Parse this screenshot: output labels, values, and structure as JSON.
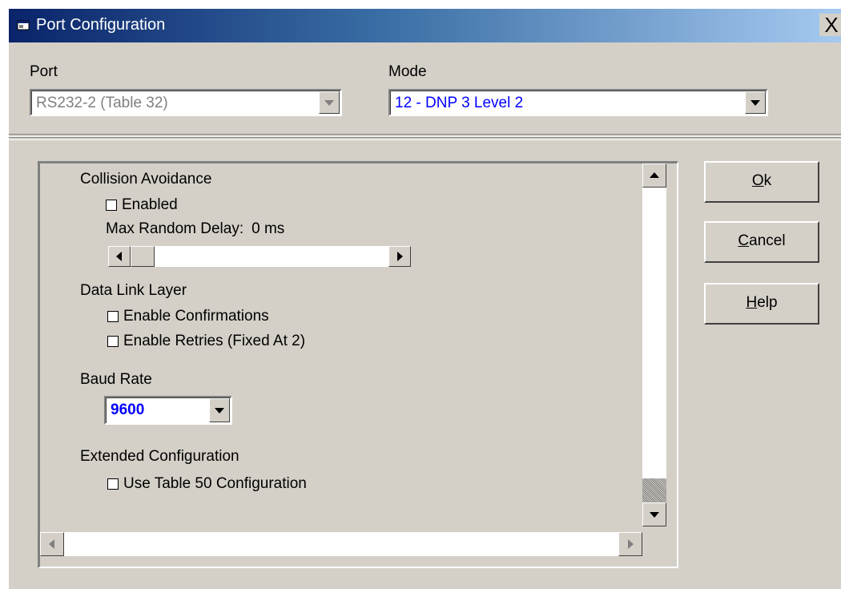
{
  "window": {
    "title": "Port Configuration",
    "close_label": "X"
  },
  "port": {
    "label": "Port",
    "value": "RS232-2 (Table 32)"
  },
  "mode": {
    "label": "Mode",
    "value": "12 - DNP 3 Level 2"
  },
  "collision": {
    "heading": "Collision Avoidance",
    "enabled_label": "Enabled",
    "delay_label": "Max Random Delay:",
    "delay_value": "0 ms",
    "slider_fraction": 0
  },
  "datalink": {
    "heading": "Data Link Layer",
    "confirmations_label": "Enable Confirmations",
    "retries_label": "Enable Retries (Fixed At 2)"
  },
  "baud": {
    "heading": "Baud Rate",
    "value": "9600"
  },
  "extended": {
    "heading": "Extended Configuration",
    "use_table_label": "Use Table 50 Configuration"
  },
  "buttons": {
    "ok_mnemonic": "O",
    "ok_rest": "k",
    "cancel_mnemonic": "C",
    "cancel_rest": "ancel",
    "help_mnemonic": "H",
    "help_rest": "elp"
  },
  "colors": {
    "value_text": "#0000ff",
    "disabled_text": "#808080",
    "title_start": "#0a246a",
    "title_end": "#a6caf0"
  },
  "icons": [
    "app-window-icon",
    "close-icon",
    "chevron-down-icon",
    "scroll-up-icon",
    "scroll-down-icon",
    "scroll-left-icon",
    "scroll-right-icon"
  ]
}
